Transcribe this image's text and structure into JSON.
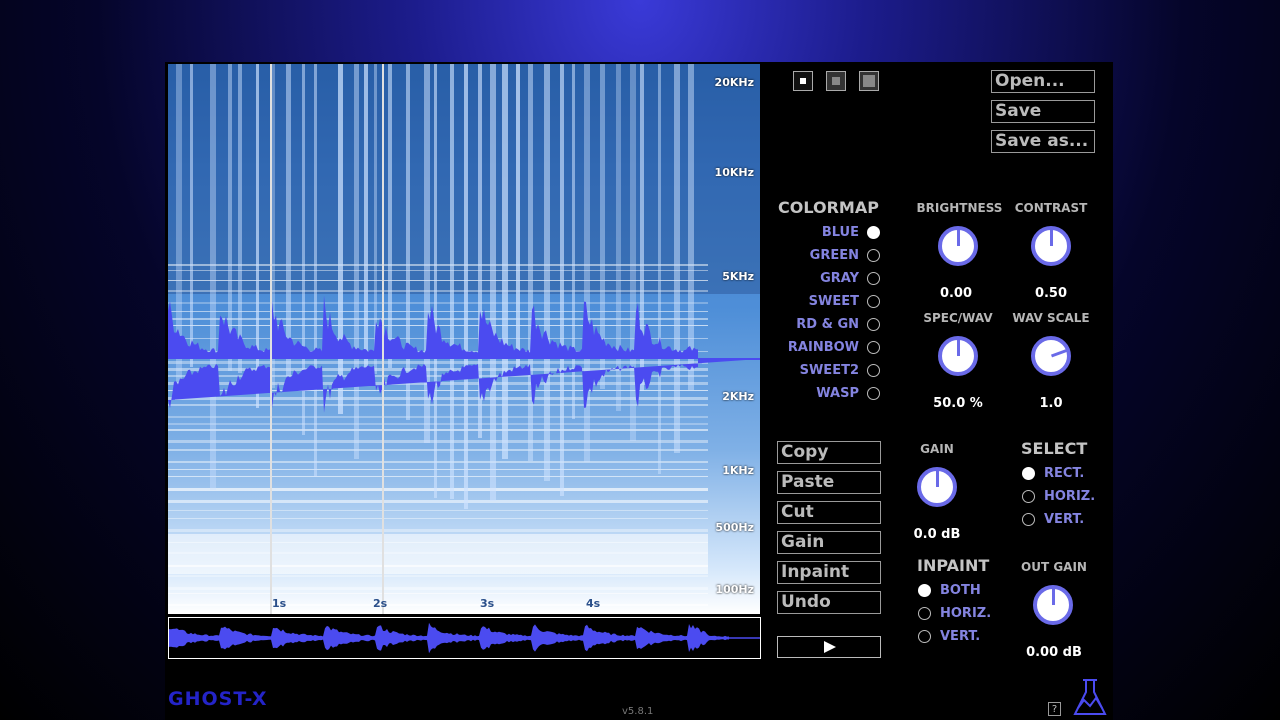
{
  "spectrogram": {
    "freq_labels": [
      "20KHz",
      "10KHz",
      "5KHz",
      "2KHz",
      "1KHz",
      "500Hz",
      "100Hz"
    ],
    "time_labels": [
      "1s",
      "2s",
      "3s",
      "4s"
    ]
  },
  "file_menu": {
    "open": "Open...",
    "save": "Save",
    "save_as": "Save as..."
  },
  "colormap": {
    "title": "COLORMAP",
    "options": [
      "BLUE",
      "GREEN",
      "GRAY",
      "SWEET",
      "RD & GN",
      "RAINBOW",
      "SWEET2",
      "WASP"
    ],
    "selected": "BLUE"
  },
  "knobs": {
    "brightness": {
      "label": "BRIGHTNESS",
      "value": "0.00"
    },
    "contrast": {
      "label": "CONTRAST",
      "value": "0.50"
    },
    "spec_wav": {
      "label": "SPEC/WAV",
      "value": "50.0 %"
    },
    "wav_scale": {
      "label": "WAV SCALE",
      "value": "1.0"
    },
    "gain": {
      "label": "GAIN",
      "value": "0.0 dB"
    },
    "out_gain": {
      "label": "OUT GAIN",
      "value": "0.00 dB"
    }
  },
  "edit": {
    "copy": "Copy",
    "paste": "Paste",
    "cut": "Cut",
    "gain": "Gain",
    "inpaint": "Inpaint",
    "undo": "Undo"
  },
  "select": {
    "title": "SELECT",
    "options": [
      "RECT.",
      "HORIZ.",
      "VERT."
    ],
    "selected": "RECT."
  },
  "inpaint": {
    "title": "INPAINT",
    "options": [
      "BOTH",
      "HORIZ.",
      "VERT."
    ],
    "selected": "BOTH"
  },
  "footer": {
    "logo": "GHOST-X",
    "version": "v5.8.1",
    "help": "?"
  },
  "colors": {
    "waveform": "#4b4bf0",
    "accent": "#6a6ae8",
    "label": "#8484e0"
  }
}
